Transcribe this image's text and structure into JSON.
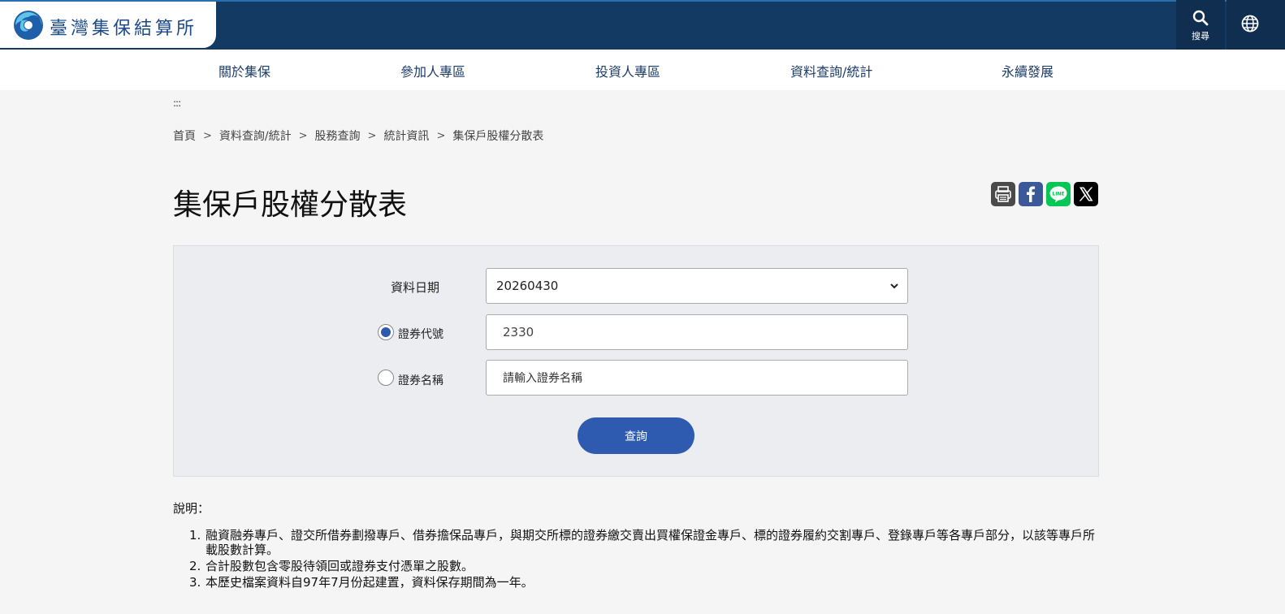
{
  "header": {
    "access_key": ":::",
    "logo_text": "臺灣集保結算所",
    "search_label": "搜尋",
    "brand_color": "#133a63",
    "accent_color": "#2e5bb0"
  },
  "nav": {
    "items": [
      "關於集保",
      "參加人專區",
      "投資人專區",
      "資料查詢/統計",
      "永續發展"
    ]
  },
  "main_access_key": ":::",
  "breadcrumb": {
    "items": [
      "首頁",
      "資料查詢/統計",
      "股務查詢",
      "統計資訊",
      "集保戶股權分散表"
    ],
    "separator": ">"
  },
  "page_title": "集保戶股權分散表",
  "share": {
    "icons": [
      "print-icon",
      "facebook-icon",
      "line-icon",
      "x-icon"
    ],
    "line_text": "LINE"
  },
  "form": {
    "date_label": "資料日期",
    "date_value": "20260430",
    "code_label": "證券代號",
    "code_value": "2330",
    "code_selected": true,
    "name_label": "證券名稱",
    "name_placeholder": "請輸入證券名稱",
    "submit_label": "查詢"
  },
  "notes": {
    "title": "說明：",
    "items": [
      {
        "num": "1.",
        "text": "融資融券專戶、證交所借券劃撥專戶、借券擔保品專戶，與期交所標的證券繳交賣出買權保證金專戶、標的證券履約交割專戶、登錄專戶等各專戶部分，以該等專戶所載股數計算。"
      },
      {
        "num": "2.",
        "text": "合計股數包含零股待領回或證券支付憑單之股數。"
      },
      {
        "num": "3.",
        "text": "本歷史檔案資料自97年7月份起建置，資料保存期間為一年。"
      }
    ]
  }
}
